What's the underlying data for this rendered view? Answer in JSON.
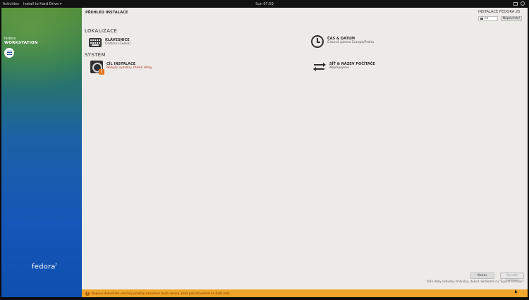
{
  "topbar": {
    "activities": "Activities",
    "app_menu": "Install to Hard Drive ▾",
    "clock": "Sun 07:59"
  },
  "sidebar": {
    "brand_small": "fedora",
    "brand_big": "WORKSTATION",
    "logo_text": "fedora"
  },
  "header": {
    "hub_title": "PŘEHLED INSTALACE",
    "product": "INSTALACE FEDORA 25",
    "keyboard_layout": "cz",
    "help_label": "Nápověda!"
  },
  "sections": {
    "localization": "LOKALIZACE",
    "system": "SYSTÉM"
  },
  "spokes": {
    "keyboard": {
      "title": "KLÁVESNICE",
      "status": "Čeština (Česká)"
    },
    "datetime": {
      "title": "ČAS & DATUM",
      "status": "Časové pásmo Europe/Praha"
    },
    "destination": {
      "title": "CÍL INSTALACE",
      "status": "Nebyly vybrány žádné disky"
    },
    "network": {
      "title": "SÍŤ & NÁZEV POČÍTAČE",
      "status": "Nepřipojeno"
    }
  },
  "footer": {
    "quit_label": "Konec",
    "begin_label": "Spustit instalaci",
    "hint": "Vaše disky nebudou změněny, dokud nekliknete na 'Spustit instalaci'.",
    "warning": "Nejprve dokončete všechny položky označené touto ikonou, před pokračováním na další krok."
  },
  "colors": {
    "warning_bar": "#f0a429",
    "warning_text": "#b7392c",
    "sidebar_blue": "#1556b8"
  }
}
